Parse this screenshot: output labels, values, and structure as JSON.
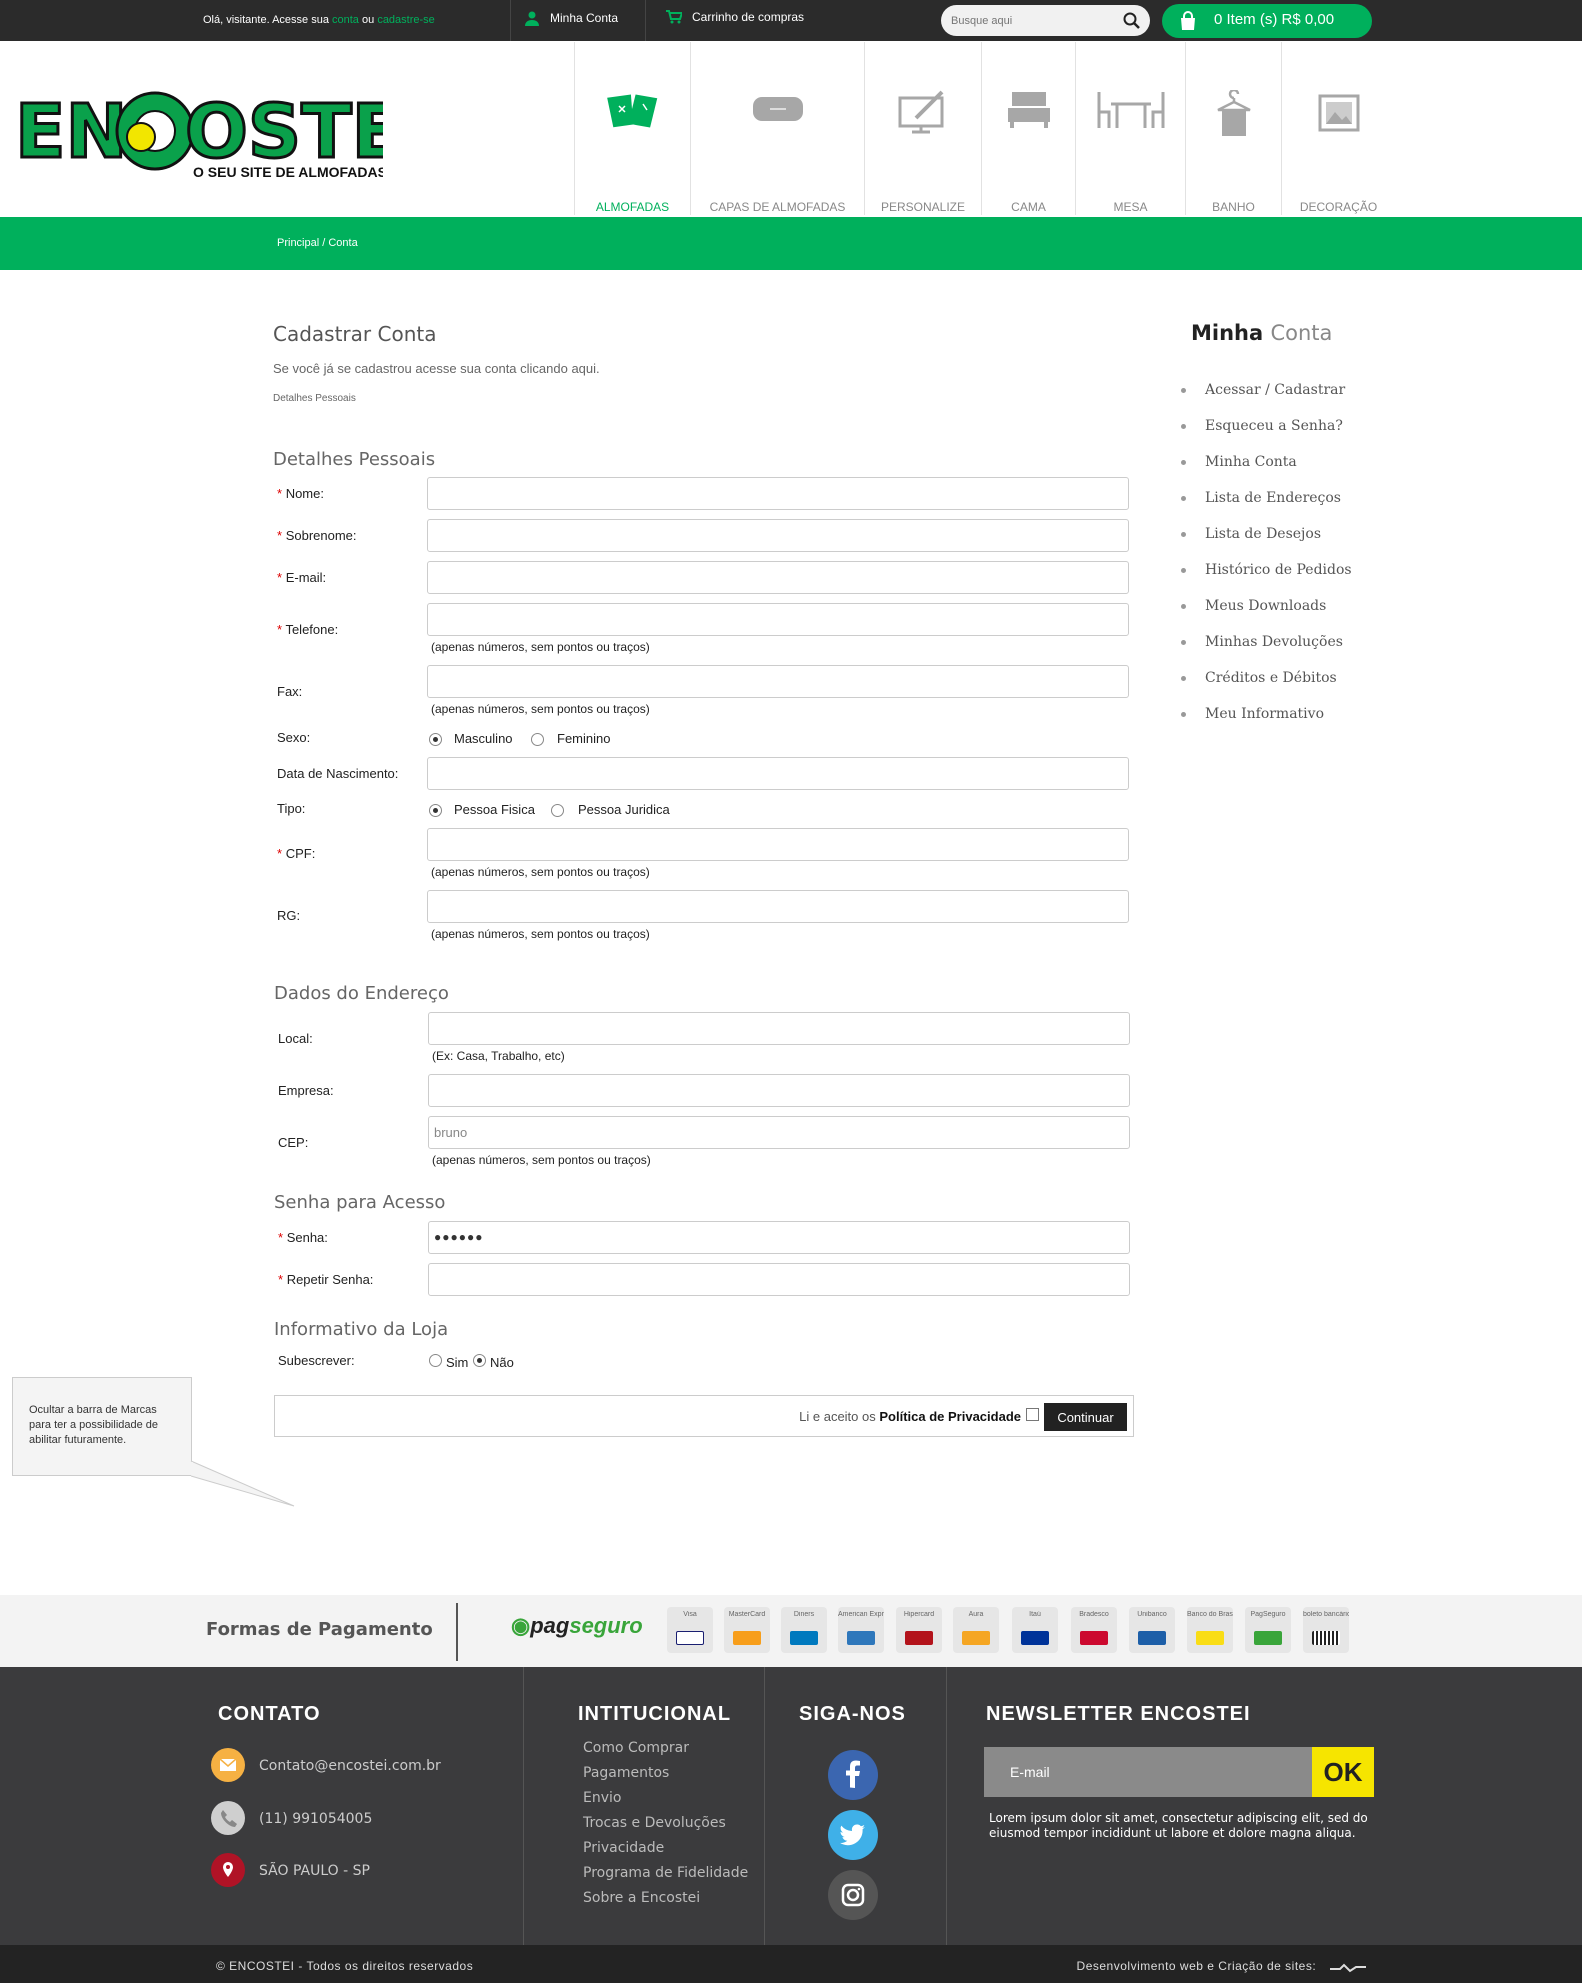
{
  "topbar": {
    "welcome_prefix": "Olá, visitante. Acesse sua",
    "link_account": "conta",
    "welcome_or": "ou",
    "link_register": "cadastre-se",
    "my_account": "Minha Conta",
    "cart_link": "Carrinho de compras",
    "search_placeholder": "Busque aqui",
    "cart_summary": "0  Item (s)    R$ 0,00"
  },
  "logo": {
    "brand": "ENCOSTEI",
    "tagline": "O SEU SITE DE ALMOFADAS"
  },
  "nav": [
    "ALMOFADAS",
    "CAPAS DE ALMOFADAS",
    "PERSONALIZE",
    "CAMA",
    "MESA",
    "BANHO",
    "DECORAÇÃO"
  ],
  "breadcrumb": "Principal / Conta",
  "form": {
    "title": "Cadastrar Conta",
    "intro": "Se você já se cadastrou acesse sua conta clicando aqui.",
    "sub": "Detalhes Pessoais",
    "sec_personal": "Detalhes Pessoais",
    "sec_address": "Dados do Endereço",
    "sec_password": "Senha para Acesso",
    "sec_news": "Informativo da Loja",
    "req": "*",
    "labels": {
      "nome": "Nome:",
      "sobrenome": "Sobrenome:",
      "email": "E-mail:",
      "telefone": "Telefone:",
      "fax": "Fax:",
      "sexo": "Sexo:",
      "nascimento": "Data de Nascimento:",
      "tipo": "Tipo:",
      "cpf": "CPF:",
      "rg": "RG:",
      "local": "Local:",
      "empresa": "Empresa:",
      "cep": "CEP:",
      "senha": "Senha:",
      "repetir": "Repetir Senha:",
      "subscrever": "Subescrever:"
    },
    "hint_numbers": "(apenas números, sem pontos ou traços)",
    "hint_local": "(Ex: Casa, Trabalho, etc)",
    "sexo_m": "Masculino",
    "sexo_f": "Feminino",
    "tipo_f": "Pessoa Fisica",
    "tipo_j": "Pessoa Juridica",
    "sub_sim": "Sim",
    "sub_nao": "Não",
    "cep_value": "bruno",
    "senha_value": "●●●●●●",
    "agree_text": "Li e aceito os",
    "agree_link": "Política de Privacidade",
    "continue": "Continuar"
  },
  "note": "Ocultar a barra de Marcas para ter a possibilidade de abilitar futuramente.",
  "sidebar": {
    "title_bold": "Minha",
    "title_light": "Conta",
    "items": [
      "Acessar / Cadastrar",
      "Esqueceu a Senha?",
      "Minha Conta",
      "Lista de Endereços",
      "Lista de Desejos",
      "Histórico de Pedidos",
      "Meus Downloads",
      "Minhas Devoluções",
      "Créditos e Débitos",
      "Meu Informativo"
    ]
  },
  "payment": {
    "title": "Formas de Pagamento",
    "brand_a": "pag",
    "brand_b": "seguro",
    "cards": [
      "Visa",
      "MasterCard",
      "Diners",
      "American Express",
      "Hipercard",
      "Aura",
      "Itaú",
      "Bradesco",
      "Unibanco",
      "Banco do Brasil",
      "PagSeguro",
      "boleto bancário"
    ]
  },
  "footer": {
    "contato": "CONTATO",
    "email": "Contato@encostei.com.br",
    "phone": "(11) 991054005",
    "location": "SÃO PAULO - SP",
    "institucional": "INTITUCIONAL",
    "links": [
      "Como Comprar",
      "Pagamentos",
      "Envio",
      "Trocas e Devoluções",
      "Privacidade",
      "Programa de Fidelidade",
      "Sobre a Encostei"
    ],
    "siga": "SIGA-NOS",
    "newsletter": "NEWSLETTER ENCOSTEI",
    "newsletter_placeholder": "E-mail",
    "ok": "OK",
    "newsletter_text": "Lorem ipsum dolor sit amet, consectetur adipiscing elit, sed do eiusmod tempor incididunt ut labore et dolore magna aliqua.",
    "copyright": "© ENCOSTEI - Todos os direitos reservados",
    "dev": "Desenvolvimento web e Criação de sites:"
  }
}
